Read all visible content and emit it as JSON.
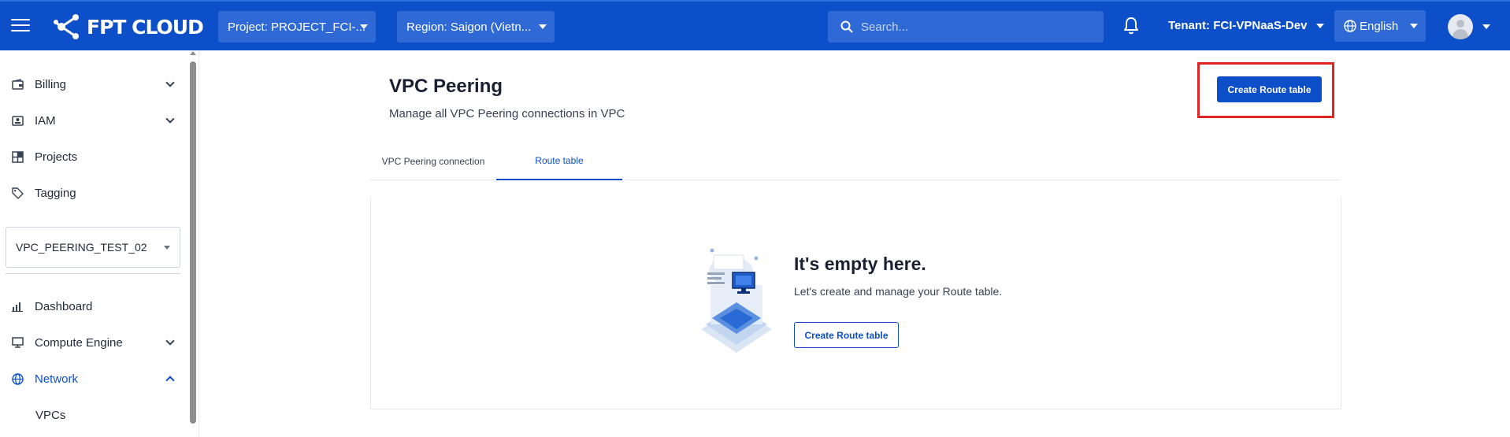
{
  "header": {
    "logo_text": "FPT CLOUD",
    "project_select": "Project: PROJECT_FCI-...",
    "region_select": "Region: Saigon (Vietn...",
    "search_placeholder": "Search...",
    "tenant": "Tenant: FCI-VPNaaS-Dev",
    "language": "English",
    "brand_color": "#0c4fc9"
  },
  "sidebar": {
    "items_top": [
      {
        "label": "Billing",
        "icon": "wallet-icon",
        "expandable": true
      },
      {
        "label": "IAM",
        "icon": "id-card-icon",
        "expandable": true
      },
      {
        "label": "Projects",
        "icon": "projects-icon",
        "expandable": false
      },
      {
        "label": "Tagging",
        "icon": "tag-icon",
        "expandable": false
      }
    ],
    "project_selector": "VPC_PEERING_TEST_02",
    "items_bottom": [
      {
        "label": "Dashboard",
        "icon": "bar-chart-icon",
        "expandable": false
      },
      {
        "label": "Compute Engine",
        "icon": "monitor-icon",
        "expandable": true
      },
      {
        "label": "Network",
        "icon": "globe-icon",
        "expandable": true,
        "expanded": true,
        "active": true
      }
    ],
    "sub_items": [
      "VPCs"
    ]
  },
  "main": {
    "title": "VPC Peering",
    "subtitle": "Manage all VPC Peering connections in VPC",
    "create_button": "Create Route table",
    "tabs": [
      {
        "label": "VPC Peering connection",
        "active": false
      },
      {
        "label": "Route table",
        "active": true
      }
    ],
    "empty_state": {
      "title": "It's empty here.",
      "message": "Let's create and manage your Route table.",
      "button": "Create Route table"
    }
  }
}
